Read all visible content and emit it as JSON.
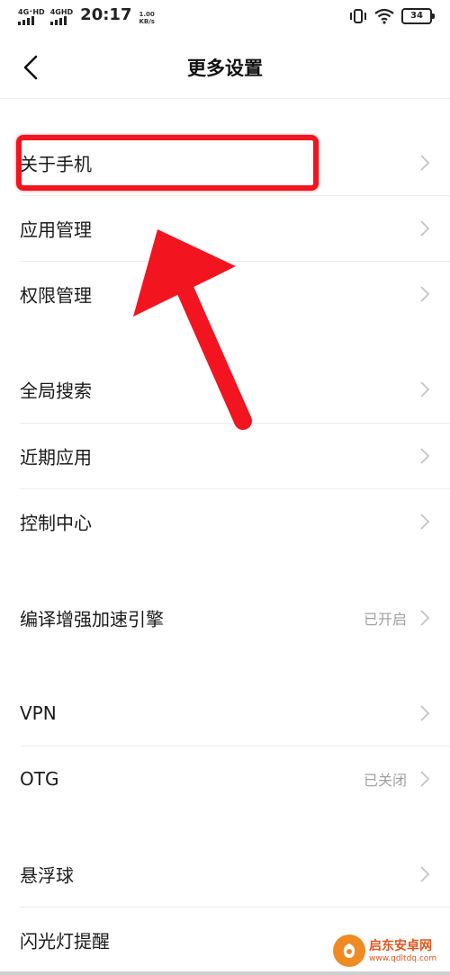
{
  "status_bar": {
    "signal1_label": "4G⁺HD",
    "signal2_label": "4GHD",
    "time": "20:17",
    "net_speed_value": "1.00",
    "net_speed_unit": "KB/s",
    "battery": "34"
  },
  "header": {
    "title": "更多设置"
  },
  "rows": [
    {
      "label": "关于手机",
      "value": ""
    },
    {
      "label": "应用管理",
      "value": ""
    },
    {
      "label": "权限管理",
      "value": ""
    },
    {
      "label": "全局搜索",
      "value": ""
    },
    {
      "label": "近期应用",
      "value": ""
    },
    {
      "label": "控制中心",
      "value": ""
    },
    {
      "label": "编译增强加速引擎",
      "value": "已开启"
    },
    {
      "label": "VPN",
      "value": ""
    },
    {
      "label": "OTG",
      "value": "已关闭"
    },
    {
      "label": "悬浮球",
      "value": ""
    },
    {
      "label": "闪光灯提醒",
      "value": ""
    }
  ],
  "watermark": {
    "name": "启东安卓网",
    "url": "www.qdltdq.com"
  },
  "colors": {
    "highlight": "#f2141f",
    "value_text": "#a0a0a0",
    "watermark": "#e2561c"
  }
}
